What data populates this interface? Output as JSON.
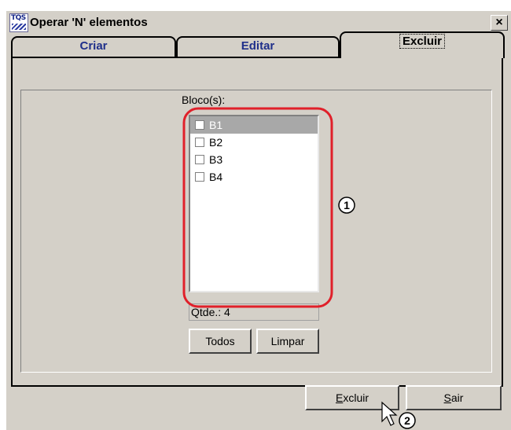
{
  "window": {
    "title": "Operar 'N' elementos",
    "icon_text": "TQS",
    "close_label": "×"
  },
  "tabs": [
    {
      "label": "Criar",
      "active": false
    },
    {
      "label": "Editar",
      "active": false
    },
    {
      "label": "Excluir",
      "active": true
    }
  ],
  "blocks": {
    "label": "Bloco(s):",
    "items": [
      {
        "label": "B1",
        "checked": false,
        "selected": true
      },
      {
        "label": "B2",
        "checked": false,
        "selected": false
      },
      {
        "label": "B3",
        "checked": false,
        "selected": false
      },
      {
        "label": "B4",
        "checked": false,
        "selected": false
      }
    ],
    "count_text": "Qtde.: 4"
  },
  "buttons": {
    "todos": "Todos",
    "limpar": "Limpar",
    "excluir_accel": "E",
    "excluir_rest": "xcluir",
    "sair_accel": "S",
    "sair_rest": "air"
  },
  "annotations": {
    "callout_1": "1",
    "callout_2": "2",
    "highlight_color": "#e0202a"
  }
}
